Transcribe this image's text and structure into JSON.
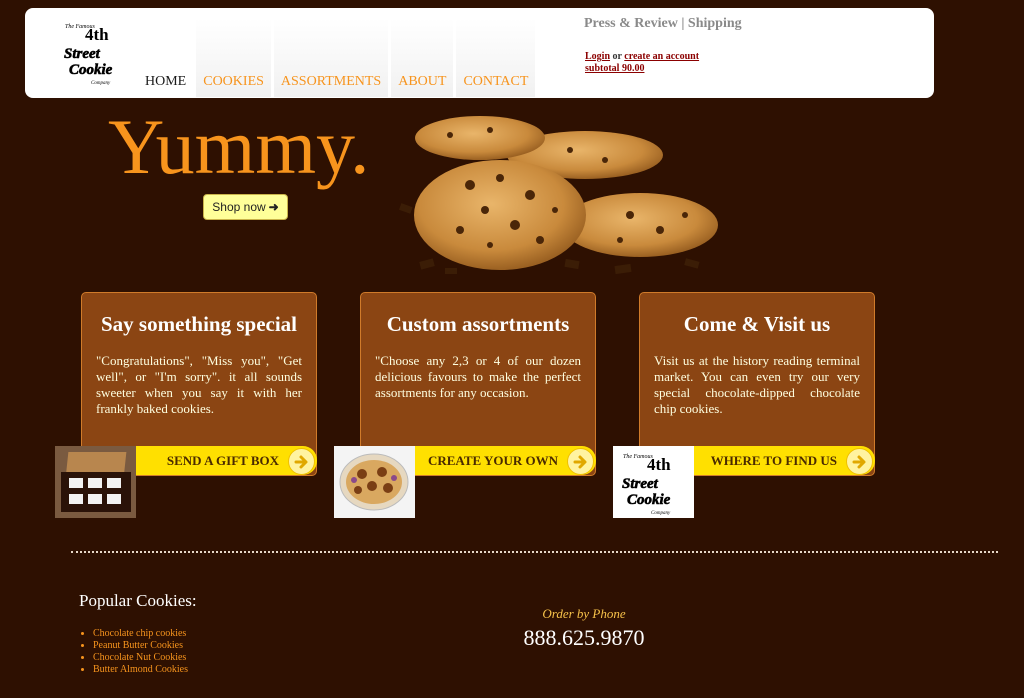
{
  "header": {
    "logo_text": [
      "The Famous",
      "4th",
      "Street",
      "Cookie",
      "Company"
    ],
    "nav": [
      "HOME",
      "COOKIES",
      "ASSORTMENTS",
      "ABOUT",
      "CONTACT"
    ],
    "press_review": "Press & Review",
    "separator": "|",
    "shipping": "Shipping",
    "login": "Login",
    "or": "or",
    "create_account": "create an account",
    "subtotal": "subtotal 90.00"
  },
  "hero": {
    "headline": "Yummy.",
    "shop_now": "Shop now"
  },
  "panels": [
    {
      "title": "Say something special",
      "text": "\"Congratulations\", \"Miss you\", \"Get well\", or \"I'm sorry\". it all sounds sweeter when you say it with her frankly baked cookies.",
      "cta": "SEND A GIFT BOX"
    },
    {
      "title": "Custom assortments",
      "text": "\"Choose any 2,3 or 4 of our dozen delicious favours to make the perfect assortments for any occasion.",
      "cta": "CREATE YOUR OWN"
    },
    {
      "title": "Come & Visit us",
      "text": "Visit us at the history reading terminal market. You can even try our very special chocolate-dipped chocolate chip cookies.",
      "cta": "WHERE TO FIND US"
    }
  ],
  "footer": {
    "popular_title": "Popular Cookies:",
    "popular": [
      "Chocolate chip cookies",
      "Peanut Butter Cookies",
      "Chocolate Nut Cookies",
      "Butter Almond Cookies"
    ],
    "order_label": "Order by Phone",
    "phone": "888.625.9870"
  },
  "colors": {
    "background": "#2e1001",
    "accent_orange": "#f7941d",
    "panel_brown": "#8b4513",
    "cta_yellow": "#ffe000"
  }
}
